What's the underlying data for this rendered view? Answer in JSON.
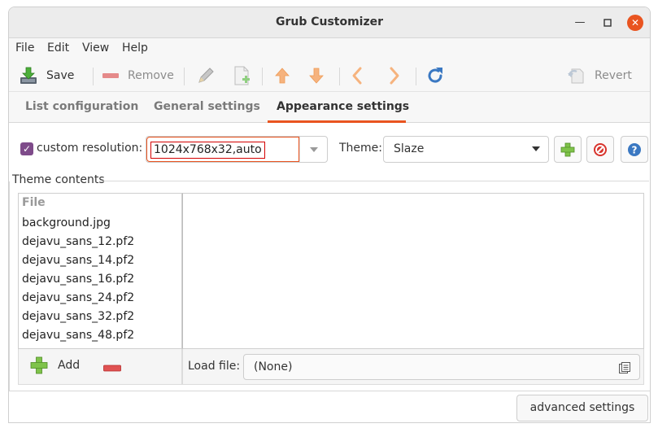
{
  "window": {
    "title": "Grub Customizer"
  },
  "menu": [
    "File",
    "Edit",
    "View",
    "Help"
  ],
  "toolbar": {
    "save": "Save",
    "remove": "Remove",
    "revert": "Revert"
  },
  "tabs": [
    "List configuration",
    "General settings",
    "Appearance settings"
  ],
  "active_tab": 2,
  "resolution": {
    "label": "custom resolution:",
    "checked": true,
    "value": "1024x768x32,auto"
  },
  "theme": {
    "label": "Theme:",
    "value": "Slaze"
  },
  "theme_contents": {
    "label": "Theme contents",
    "header": "File",
    "files": [
      "background.jpg",
      "dejavu_sans_12.pf2",
      "dejavu_sans_14.pf2",
      "dejavu_sans_16.pf2",
      "dejavu_sans_24.pf2",
      "dejavu_sans_32.pf2",
      "dejavu_sans_48.pf2"
    ]
  },
  "actions": {
    "add": "Add"
  },
  "load_file": {
    "label": "Load file:",
    "value": "(None)"
  },
  "advanced": {
    "label": "advanced settings"
  },
  "colors": {
    "accent": "#e95420",
    "checkbox": "#7e4b8a",
    "highlight_border": "#d40000"
  }
}
